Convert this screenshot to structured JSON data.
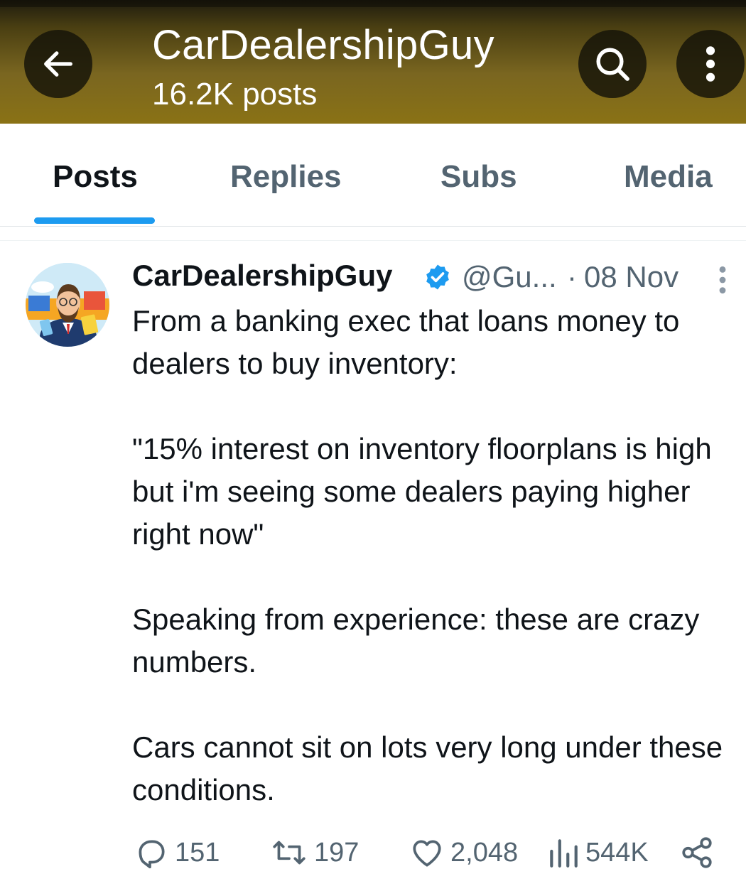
{
  "header": {
    "title": "CarDealershipGuy",
    "subtitle": "16.2K posts",
    "back_icon": "arrow-left-icon",
    "search_icon": "search-icon",
    "more_icon": "more-vertical-icon"
  },
  "tabs": [
    {
      "label": "Posts",
      "active": true
    },
    {
      "label": "Replies",
      "active": false
    },
    {
      "label": "Subs",
      "active": false
    },
    {
      "label": "Media",
      "active": false
    }
  ],
  "post": {
    "author_name": "CarDealershipGuy",
    "handle": "@Gu...",
    "separator": "·",
    "date": "08 Nov",
    "paragraphs": [
      "From a banking exec that loans money to dealers to buy inventory:",
      "\"15% interest on inventory floorplans is high but i'm seeing some dealers paying higher right now\"",
      "Speaking from experience: these are crazy numbers.",
      "Cars cannot sit on lots very long under these conditions."
    ],
    "stats": {
      "replies": "151",
      "reposts": "197",
      "likes": "2,048",
      "views": "544K"
    }
  },
  "colors": {
    "accent": "#1d9bf0",
    "muted_text": "#536471",
    "header_bg": "#7a6620"
  }
}
